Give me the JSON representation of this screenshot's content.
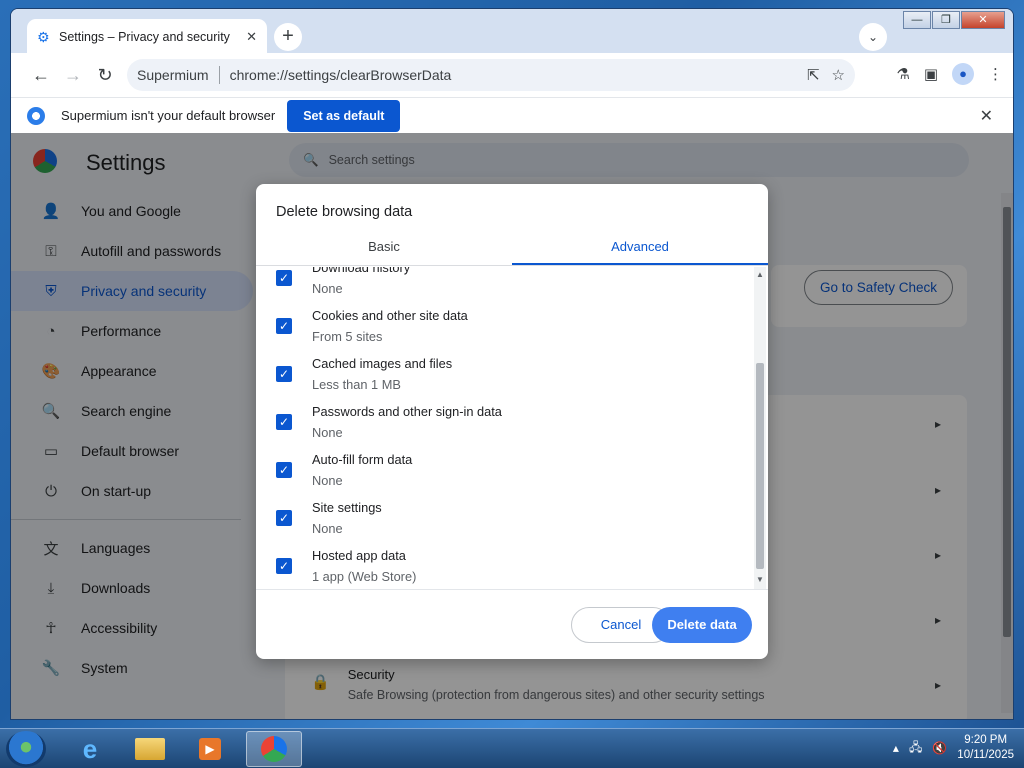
{
  "window": {
    "tab_title": "Settings – Privacy and security",
    "window_controls": [
      "—",
      "❐",
      "✕"
    ]
  },
  "toolbar": {
    "site_label": "Supermium",
    "url": "chrome://settings/clearBrowserData"
  },
  "infobar": {
    "message": "Supermium isn't your default browser",
    "button": "Set as default"
  },
  "settings": {
    "title": "Settings",
    "search_placeholder": "Search settings",
    "sidebar": [
      {
        "label": "You and Google",
        "icon": "person-icon"
      },
      {
        "label": "Autofill and passwords",
        "icon": "key-icon"
      },
      {
        "label": "Privacy and security",
        "icon": "shield-icon",
        "active": true
      },
      {
        "label": "Performance",
        "icon": "speedometer-icon"
      },
      {
        "label": "Appearance",
        "icon": "palette-icon"
      },
      {
        "label": "Search engine",
        "icon": "search-icon"
      },
      {
        "label": "Default browser",
        "icon": "browser-icon"
      },
      {
        "label": "On start-up",
        "icon": "power-icon"
      }
    ],
    "sidebar2": [
      {
        "label": "Languages",
        "icon": "translate-icon"
      },
      {
        "label": "Downloads",
        "icon": "download-icon"
      },
      {
        "label": "Accessibility",
        "icon": "accessibility-icon"
      },
      {
        "label": "System",
        "icon": "wrench-icon"
      }
    ],
    "safety_check_button": "Go to Safety Check",
    "security_row": {
      "title": "Security",
      "subtitle": "Safe Browsing (protection from dangerous sites) and other security settings"
    }
  },
  "dialog": {
    "title": "Delete browsing data",
    "tabs": [
      {
        "label": "Basic",
        "selected": false
      },
      {
        "label": "Advanced",
        "selected": true
      }
    ],
    "items": [
      {
        "title": "Download history",
        "subtitle": "None",
        "checked": true
      },
      {
        "title": "Cookies and other site data",
        "subtitle": "From 5 sites",
        "checked": true
      },
      {
        "title": "Cached images and files",
        "subtitle": "Less than 1 MB",
        "checked": true
      },
      {
        "title": "Passwords and other sign-in data",
        "subtitle": "None",
        "checked": true
      },
      {
        "title": "Auto-fill form data",
        "subtitle": "None",
        "checked": true
      },
      {
        "title": "Site settings",
        "subtitle": "None",
        "checked": true
      },
      {
        "title": "Hosted app data",
        "subtitle": "1 app (Web Store)",
        "checked": true
      }
    ],
    "cancel": "Cancel",
    "delete": "Delete data"
  },
  "taskbar": {
    "time": "9:20 PM",
    "date": "10/11/2025"
  }
}
